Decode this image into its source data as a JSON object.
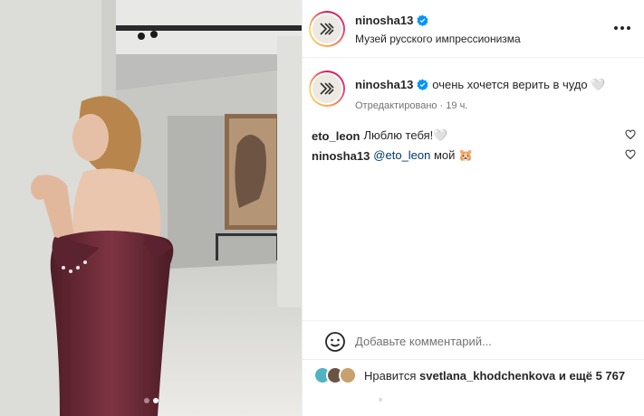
{
  "post": {
    "image": {
      "alt": "",
      "dots": [
        false,
        true
      ]
    }
  },
  "header": {
    "username": "ninosha13",
    "location": "Музей русского импрессионизма",
    "more_icon": "more-horizontal-icon"
  },
  "caption": {
    "username": "ninosha13",
    "text": "очень хочется верить в чудо 🤍",
    "edited": "Отредактировано · 19 ч."
  },
  "comments": [
    {
      "username": "eto_leon",
      "text": "Люблю тебя!🤍",
      "mention": ""
    },
    {
      "username": "ninosha13",
      "text": " мой 🐹",
      "mention": "@eto_leon"
    }
  ],
  "add_comment": {
    "placeholder": "Добавьте комментарий..."
  },
  "likes": {
    "prefix": "Нравится",
    "user": "svetlana_khodchenkova",
    "suffix": "и ещё 5 767"
  },
  "colors": {
    "verified": "#0095f6",
    "dress": "#6b2a36",
    "wall": "#d9d9d6"
  }
}
